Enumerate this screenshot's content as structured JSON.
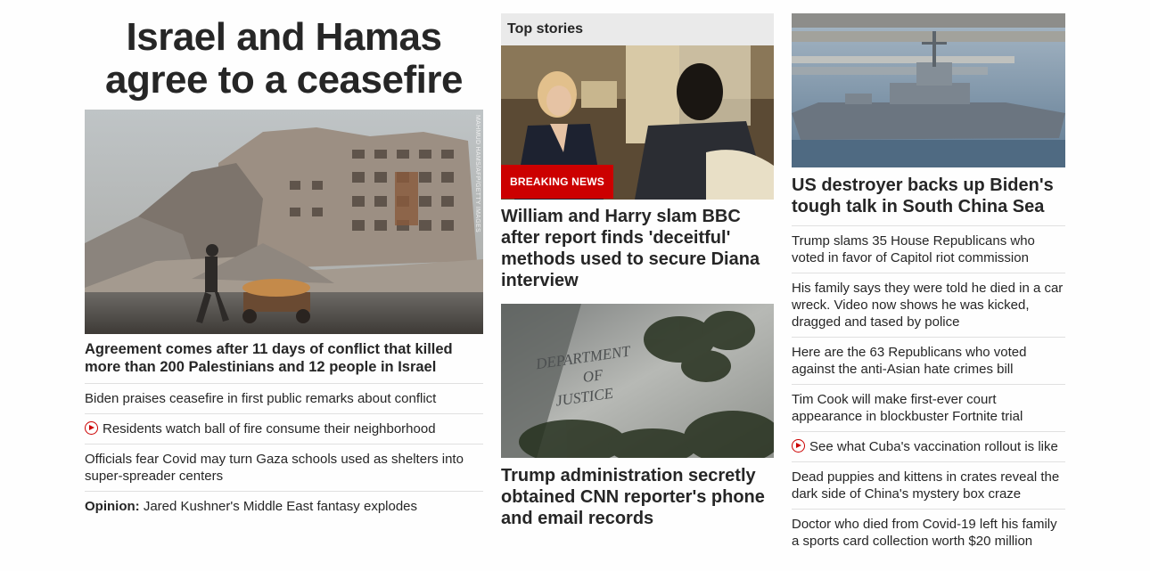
{
  "main": {
    "headline": "Israel and Hamas agree to a ceasefire",
    "photo_credit": "MAHMUD HAMS/AFP/GETTY IMAGES",
    "lead": "Agreement comes after 11 days of conflict that killed more than 200 Palestinians and 12 people in Israel",
    "items": [
      {
        "text": "Biden praises ceasefire in first public remarks about conflict",
        "video": false
      },
      {
        "text": "Residents watch ball of fire consume their neighborhood",
        "video": true
      },
      {
        "text": "Officials fear Covid may turn Gaza schools used as shelters into super-spreader centers",
        "video": false
      }
    ],
    "opinion_label": "Opinion:",
    "opinion_text": " Jared Kushner's Middle East fantasy explodes"
  },
  "top_stories": {
    "label": "Top stories",
    "breaking_label": "BREAKING NEWS",
    "story1_title": "William and Harry slam BBC after report finds 'deceitful' methods used to secure Diana interview",
    "doj_sign": [
      "DEPARTMENT",
      "OF",
      "JUSTICE"
    ],
    "story2_title": "Trump administration secretly obtained CNN reporter's phone and email records"
  },
  "right": {
    "title": "US destroyer backs up Biden's tough talk in South China Sea",
    "items": [
      {
        "text": "Trump slams 35 House Republicans who voted in favor of Capitol riot commission",
        "video": false
      },
      {
        "text": "His family says they were told he died in a car wreck. Video now shows he was kicked, dragged and tased by police",
        "video": false
      },
      {
        "text": "Here are the 63 Republicans who voted against the anti-Asian hate crimes bill",
        "video": false
      },
      {
        "text": "Tim Cook will make first-ever court appearance in blockbuster Fortnite trial",
        "video": false
      },
      {
        "text": "See what Cuba's vaccination rollout is like",
        "video": true
      },
      {
        "text": "Dead puppies and kittens in crates reveal the dark side of China's mystery box craze",
        "video": false
      },
      {
        "text": "Doctor who died from Covid-19 left his family a sports card collection worth $20 million",
        "video": false
      }
    ]
  },
  "colors": {
    "accent": "#cc0000",
    "text": "#262626",
    "label_bg": "#eaeaea"
  }
}
